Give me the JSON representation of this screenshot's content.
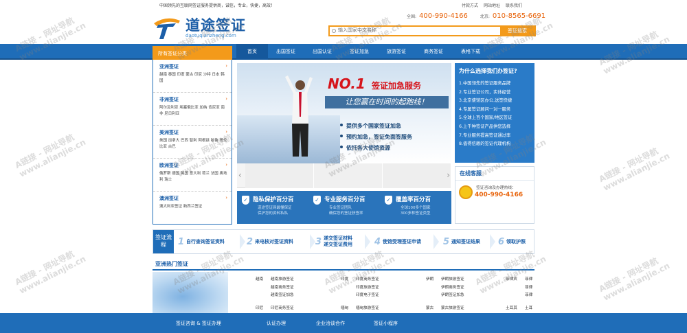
{
  "header": {
    "tagline": "中国领先的互联网签证服务提供商，诚信，专业，快捷，高效！",
    "links": [
      "付款方式",
      "网站地址",
      "联系我们"
    ],
    "logo_name": "道途签证",
    "logo_pinyin": "daotuqianzheng.com",
    "phones": [
      {
        "label": "全国:",
        "number": "400-990-4166"
      },
      {
        "label": "北京:",
        "number": "010-8565-6691"
      }
    ],
    "search_placeholder": "输入国家中文名称",
    "search_button": "签证搜索"
  },
  "nav": {
    "all_label": "所有签证分类",
    "items": [
      "首页",
      "出国签证",
      "出国认证",
      "签证加急",
      "旅游签证",
      "商务签证",
      "表格下载"
    ]
  },
  "sidebar": [
    {
      "title": "亚洲签证",
      "countries": "越南 泰国 印度 蒙古 印尼 沙特 日本 韩国"
    },
    {
      "title": "非洲签证",
      "countries": "阿尔及利亚 埃塞俄比亚 加纳 肯尼亚 南非 尼日利亚"
    },
    {
      "title": "美洲签证",
      "countries": "美国 加拿大 巴西 智利 阿根廷 秘鲁 哥伦比亚 古巴"
    },
    {
      "title": "欧洲签证",
      "countries": "俄罗斯 德国 英国 意大利 荷兰 法国 奥地利 瑞士"
    },
    {
      "title": "澳洲签证",
      "countries": "澳大利亚签证 新西兰签证"
    }
  ],
  "banner": {
    "no1": "NO.1",
    "service": "签证加急服务",
    "slogan": "让您赢在时间的起跑线！",
    "bullets": [
      "提供多个国家签证加急",
      "预约加急，签证免面签服务",
      "依托各大使馆资源"
    ]
  },
  "guarantees": [
    {
      "title": "隐私保护百分百",
      "desc": [
        "道途签证网最懂保证",
        "保护您的资料私私"
      ]
    },
    {
      "title": "专业服务百分百",
      "desc": [
        "专业签证团队",
        "确保您的签证获签率"
      ]
    },
    {
      "title": "覆盖率百分百",
      "desc": [
        "全球100多个国家",
        "300多种签证类型"
      ]
    }
  ],
  "why": {
    "title": "为什么选择我们办签证?",
    "items": [
      "1.中国领先的签证服务品牌",
      "2.专业签证公司，实体经营",
      "3.北京使馆区办公,送签快捷",
      "4.专属签证顾问一对一服务",
      "5.全球上百个国家/地区签证",
      "6.上千种签证产品供您选择",
      "7.专业服务提高签证通过率",
      "8.值得信赖的签证代理机构"
    ]
  },
  "online": {
    "title": "在线客服",
    "label": "签证咨询及办理热线：",
    "phone": "400-990-4166"
  },
  "flow": {
    "head": "签证流程",
    "steps": [
      {
        "n": "1",
        "text": "自行查询签证资料"
      },
      {
        "n": "2",
        "text": "来电核对签证资料"
      },
      {
        "n": "3",
        "text": "递交签证材料 递交签证费用"
      },
      {
        "n": "4",
        "text": "使馆受理签证申请"
      },
      {
        "n": "5",
        "text": "通知签证结果"
      },
      {
        "n": "6",
        "text": "领取护照"
      }
    ]
  },
  "hot": {
    "title": "亚洲热门签证",
    "columns": [
      {
        "lines": [
          "越南",
          "",
          "",
          ""
        ]
      },
      {
        "lines": [
          "越南旅游签证",
          "越南商务签证",
          "越南签证加急",
          ""
        ]
      },
      {
        "lines": [
          "印度",
          "",
          "",
          ""
        ]
      },
      {
        "lines": [
          "印度商务签证",
          "印度旅游签证",
          "印度电子签证",
          ""
        ]
      },
      {
        "lines": [
          "伊朗",
          "",
          "",
          ""
        ]
      },
      {
        "lines": [
          "伊朗旅游签证",
          "伊朗商务签证",
          "伊朗签证加急",
          ""
        ]
      },
      {
        "lines": [
          "菲律宾",
          "",
          "",
          ""
        ]
      },
      {
        "lines": [
          "菲律",
          "菲律",
          "菲律",
          ""
        ]
      }
    ],
    "row2": [
      "印尼",
      "印尼商务签证",
      "缅甸",
      "缅甸旅游签证",
      "蒙古",
      "蒙古旅游签证",
      "土耳其",
      "土耳"
    ]
  },
  "footer": [
    "签证咨询 & 签证办理",
    "认证办理",
    "企业洽谈合作",
    "签证小程序"
  ],
  "watermark": {
    "line1": "A链接 - 网址导航",
    "line2": "www.alianjie.cn"
  }
}
